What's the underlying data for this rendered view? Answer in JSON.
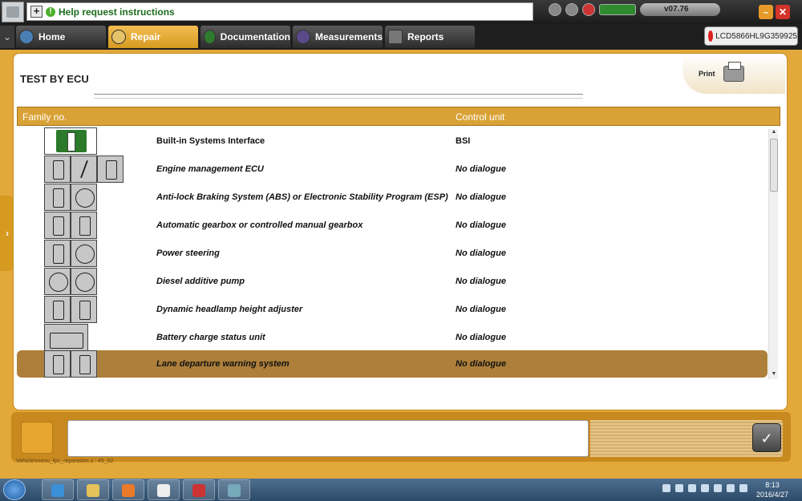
{
  "top_bar": {
    "help_label": "Help request instructions",
    "version": "v07.76"
  },
  "tabs": [
    {
      "label": "Home"
    },
    {
      "label": "Repair"
    },
    {
      "label": "Documentation"
    },
    {
      "label": "Measurements"
    },
    {
      "label": "Reports"
    }
  ],
  "device_id": "LCD5866HL9G359925",
  "page": {
    "title": "TEST BY ECU",
    "print_label": "Print"
  },
  "table": {
    "headers": {
      "family": "Family no.",
      "control_unit": "Control unit"
    },
    "rows": [
      {
        "name": "Built-in Systems Interface",
        "control_unit": "BSI"
      },
      {
        "name": "Engine management ECU",
        "control_unit": "No dialogue"
      },
      {
        "name": "Anti-lock Braking System (ABS) or Electronic Stability Program (ESP)",
        "control_unit": "No dialogue"
      },
      {
        "name": "Automatic gearbox or controlled manual gearbox",
        "control_unit": "No dialogue"
      },
      {
        "name": "Power steering",
        "control_unit": "No dialogue"
      },
      {
        "name": "Diesel additive pump",
        "control_unit": "No dialogue"
      },
      {
        "name": "Dynamic headlamp height adjuster",
        "control_unit": "No dialogue"
      },
      {
        "name": "Battery charge status unit",
        "control_unit": "No dialogue"
      },
      {
        "name": "Lane departure warning system",
        "control_unit": "No dialogue"
      }
    ]
  },
  "footer": {
    "path": "Vehicle\\menu_fpc_reparation.s : 45_02"
  },
  "taskbar": {
    "time": "8:13",
    "date": "2016/4/27"
  },
  "colors": {
    "accent": "#e2a83a",
    "selected_row": "#ad7f3a"
  }
}
